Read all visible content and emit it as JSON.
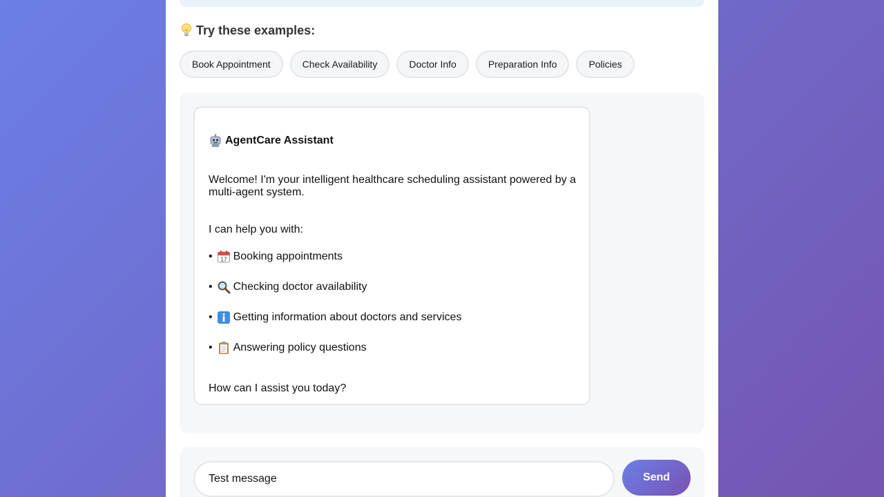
{
  "examples": {
    "title": "Try these examples:",
    "icon": "lightbulb-icon",
    "chips": [
      {
        "label": "Book Appointment"
      },
      {
        "label": "Check Availability"
      },
      {
        "label": "Doctor Info"
      },
      {
        "label": "Preparation Info"
      },
      {
        "label": "Policies"
      }
    ]
  },
  "message": {
    "icon": "robot-icon",
    "title": "AgentCare Assistant",
    "welcome": "Welcome! I'm your intelligent healthcare scheduling assistant powered by a multi-agent system.",
    "help_intro": "I can help you with:",
    "items": [
      {
        "icon": "calendar-icon",
        "text": "Booking appointments"
      },
      {
        "icon": "magnifier-icon",
        "text": "Checking doctor availability"
      },
      {
        "icon": "info-icon",
        "text": "Getting information about doctors and services"
      },
      {
        "icon": "clipboard-icon",
        "text": "Answering policy questions"
      }
    ],
    "closing": "How can I assist you today?"
  },
  "input": {
    "value": "Test message",
    "send_label": "Send"
  },
  "colors": {
    "accent_start": "#6b7fe6",
    "accent_end": "#7a52b5"
  }
}
